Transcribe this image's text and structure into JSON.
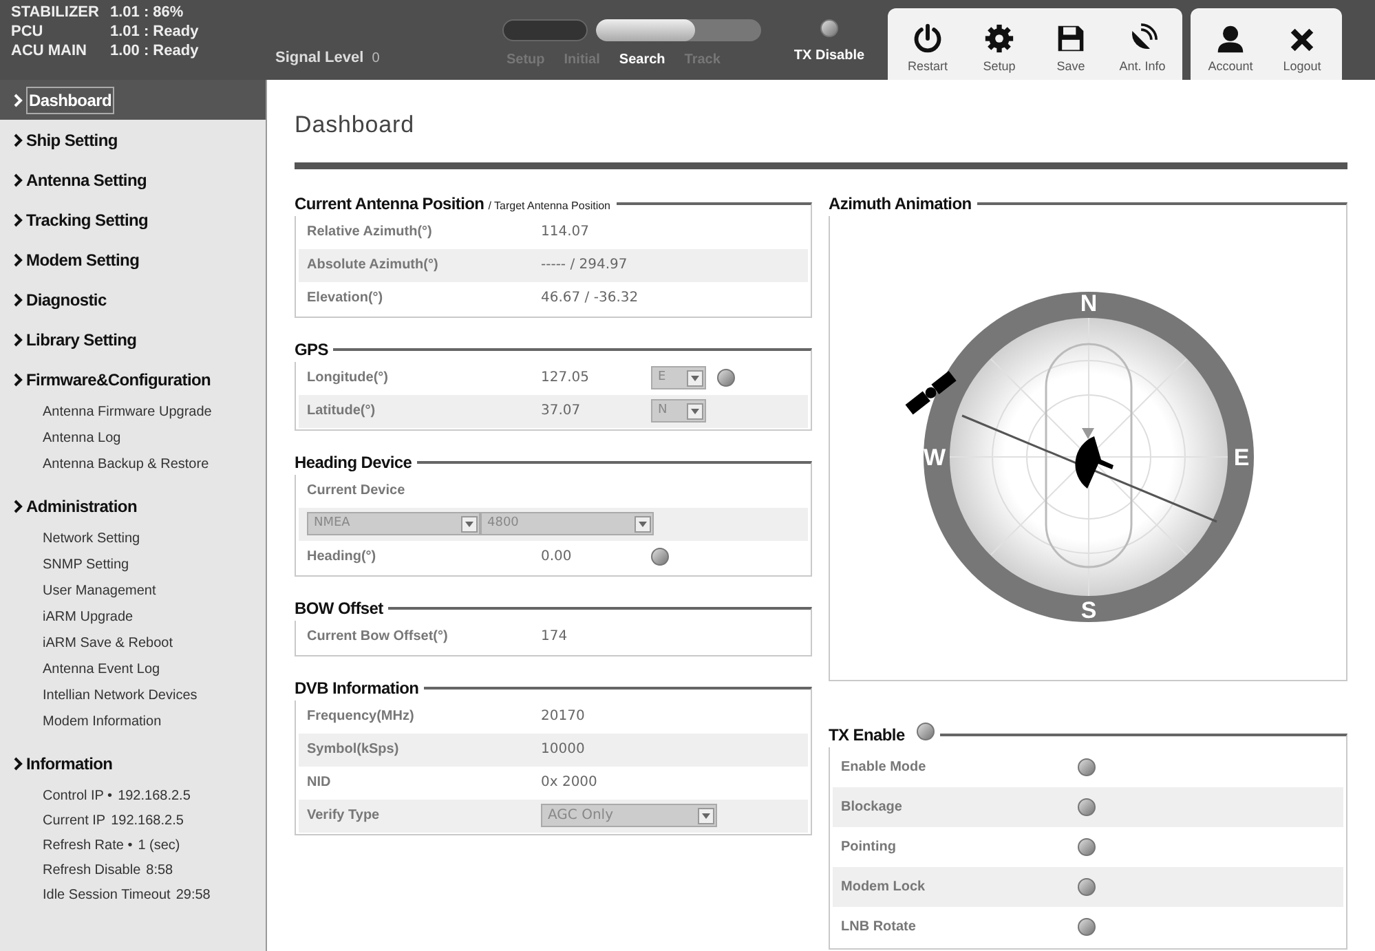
{
  "status": [
    {
      "label": "STABILIZER",
      "value": "1.01 : 86%"
    },
    {
      "label": "PCU",
      "value": "1.01 : Ready"
    },
    {
      "label": "ACU MAIN",
      "value": "1.00 : Ready"
    }
  ],
  "signal": {
    "label": "Signal Level",
    "value": "0"
  },
  "modes": [
    {
      "label": "Setup",
      "selected": false
    },
    {
      "label": "Initial",
      "selected": false
    },
    {
      "label": "Search",
      "selected": true
    },
    {
      "label": "Track",
      "selected": false
    }
  ],
  "progress": {
    "level": 0.6
  },
  "tx_disable": {
    "label": "TX Disable",
    "on": false
  },
  "toolbar": [
    {
      "kind": "power",
      "label": "Restart"
    },
    {
      "kind": "gear",
      "label": "Setup"
    },
    {
      "kind": "save",
      "label": "Save"
    },
    {
      "kind": "dish",
      "label": "Ant. Info"
    }
  ],
  "account_toolbar": [
    {
      "kind": "person",
      "label": "Account"
    },
    {
      "kind": "close",
      "label": "Logout"
    }
  ],
  "sidebar": [
    {
      "label": "Dashboard",
      "selected": true
    },
    {
      "label": "Ship Setting",
      "selected": false
    },
    {
      "label": "Antenna Setting",
      "selected": false
    },
    {
      "label": "Tracking Setting",
      "selected": false
    },
    {
      "label": "Modem Setting",
      "selected": false
    },
    {
      "label": "Diagnostic",
      "selected": false
    },
    {
      "label": "Library Setting",
      "selected": false
    },
    {
      "label": "Firmware&Configuration",
      "selected": false,
      "children": [
        {
          "label": "Antenna Firmware Upgrade"
        },
        {
          "label": "Antenna Log"
        },
        {
          "label": "Antenna Backup & Restore"
        }
      ]
    },
    {
      "label": "Administration",
      "selected": false,
      "children": [
        {
          "label": "Network Setting"
        },
        {
          "label": "SNMP Setting"
        },
        {
          "label": "User Management"
        },
        {
          "label": "iARM Upgrade"
        },
        {
          "label": "iARM Save & Reboot"
        },
        {
          "label": "Antenna Event Log"
        },
        {
          "label": "Intellian Network Devices"
        },
        {
          "label": "Modem Information"
        }
      ]
    },
    {
      "label": "Information",
      "selected": false,
      "children": [
        {
          "label": "Control IP •",
          "value": "192.168.2.5"
        },
        {
          "label": "Current IP",
          "value": "192.168.2.5"
        },
        {
          "label": "Refresh Rate •",
          "value": "1 (sec)"
        },
        {
          "label": "Refresh Disable",
          "value": "8:58"
        },
        {
          "label": "Idle Session Timeout",
          "value": "29:58"
        }
      ]
    }
  ],
  "page_title": "Dashboard",
  "left_panels": [
    {
      "title": "Current Antenna Position",
      "subtitle": "/ Target Antenna Position",
      "rows": [
        {
          "kind": "text",
          "label": "Relative Azimuth(°)",
          "value": "114.07"
        },
        {
          "kind": "text",
          "label": "Absolute Azimuth(°)",
          "value": "----- / 294.97"
        },
        {
          "kind": "text",
          "label": "Elevation(°)",
          "value": "46.67 / -36.32"
        }
      ]
    },
    {
      "title": "GPS",
      "rows": [
        {
          "kind": "text",
          "label": "Longitude(°)",
          "value": "127.05",
          "select": "E",
          "led": false
        },
        {
          "kind": "text",
          "label": "Latitude(°)",
          "value": "37.07",
          "select": "N"
        }
      ]
    },
    {
      "title": "Heading Device",
      "rows": [
        {
          "kind": "heading",
          "label": "Current Device"
        },
        {
          "kind": "selects",
          "options": [
            "NMEA",
            "4800"
          ]
        },
        {
          "kind": "text",
          "label": "Heading(°)",
          "value": "0.00",
          "led": false
        }
      ]
    },
    {
      "title": "BOW Offset",
      "rows": [
        {
          "kind": "text",
          "label": "Current Bow Offset(°)",
          "value": "174"
        }
      ]
    },
    {
      "title": "DVB Information",
      "rows": [
        {
          "kind": "text",
          "label": "Frequency(MHz)",
          "value": "20170"
        },
        {
          "kind": "text",
          "label": "Symbol(kSps)",
          "value": "10000"
        },
        {
          "kind": "text",
          "label": "NID",
          "value": "0x 2000"
        },
        {
          "kind": "select",
          "label": "Verify Type",
          "value": "AGC Only"
        }
      ]
    }
  ],
  "azimuth": {
    "title": "Azimuth Animation",
    "compass_labels": [
      "N",
      "E",
      "S",
      "W"
    ]
  },
  "tx_enable": {
    "title": "TX Enable",
    "on": false,
    "rows": [
      {
        "label": "Enable Mode",
        "on": false
      },
      {
        "label": "Blockage",
        "on": false
      },
      {
        "label": "Pointing",
        "on": false
      },
      {
        "label": "Modem Lock",
        "on": false
      },
      {
        "label": "LNB Rotate",
        "on": false
      }
    ]
  }
}
